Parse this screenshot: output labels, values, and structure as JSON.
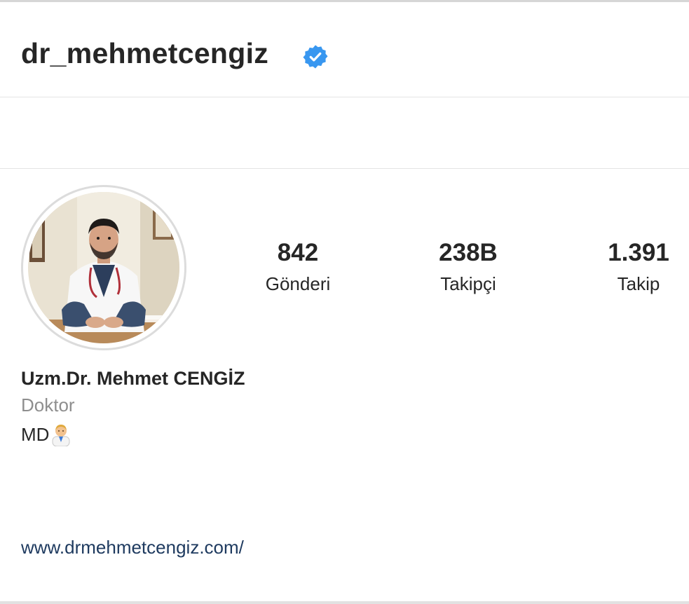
{
  "header": {
    "username": "dr_mehmetcengiz",
    "verified_icon": "verified-badge-icon"
  },
  "profile": {
    "avatar_icon": "profile-photo"
  },
  "stats": [
    {
      "value": "842",
      "label": "Gönderi"
    },
    {
      "value": "238B",
      "label": "Takipçi"
    },
    {
      "value": "1.391",
      "label": "Takip"
    }
  ],
  "bio": {
    "name": "Uzm.Dr. Mehmet CENGİZ",
    "category": "Doktor",
    "text": "MD",
    "emoji_icon": "doctor-emoji-icon",
    "website": "www.drmehmetcengiz.com/"
  },
  "colors": {
    "verified": "#3897f0",
    "link": "#1e3a5f",
    "category": "#8e8e8e",
    "text": "#262626"
  }
}
